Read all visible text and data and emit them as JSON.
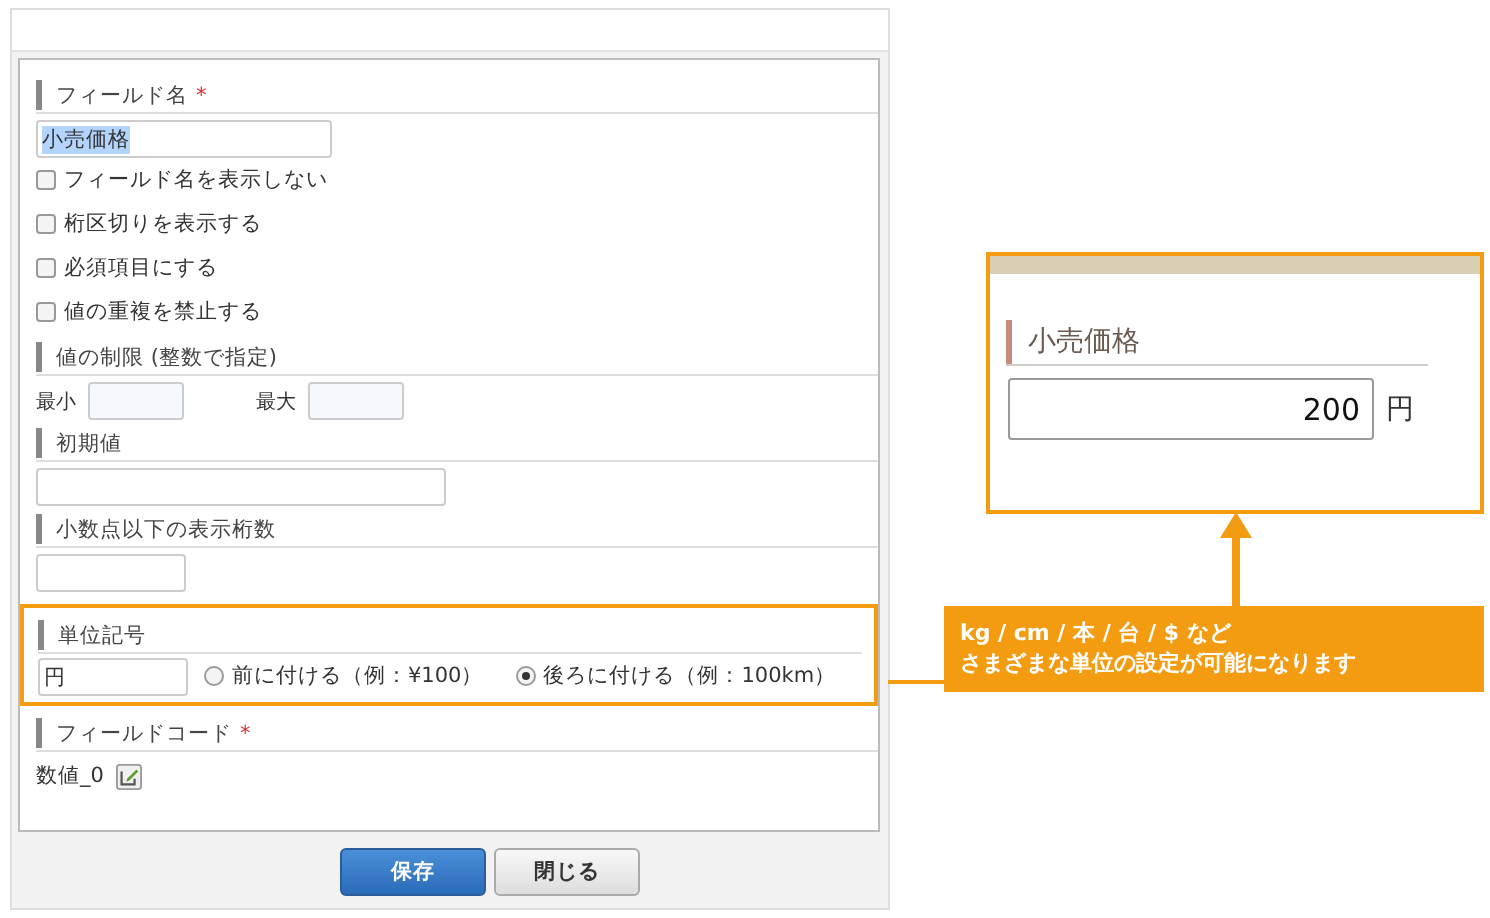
{
  "field_name": {
    "label": "フィールド名",
    "required_mark": "*",
    "value": "小売価格",
    "value_selected": true
  },
  "options": [
    {
      "label": "フィールド名を表示しない",
      "checked": false
    },
    {
      "label": "桁区切りを表示する",
      "checked": false
    },
    {
      "label": "必須項目にする",
      "checked": false
    },
    {
      "label": "値の重複を禁止する",
      "checked": false
    }
  ],
  "limit": {
    "label": "値の制限 (整数で指定)",
    "min_label": "最小",
    "max_label": "最大"
  },
  "default_value": {
    "label": "初期値"
  },
  "decimals": {
    "label": "小数点以下の表示桁数"
  },
  "unit": {
    "label": "単位記号",
    "value": "円",
    "highlighted": true,
    "positions": [
      {
        "label": "前に付ける（例：¥100）",
        "selected": false
      },
      {
        "label": "後ろに付ける（例：100km）",
        "selected": true
      }
    ]
  },
  "field_code": {
    "label": "フィールドコード",
    "required_mark": "*",
    "value": "数値_0"
  },
  "buttons": [
    {
      "label": "保存",
      "kind": "primary"
    },
    {
      "label": "閉じる",
      "kind": "secondary"
    }
  ],
  "preview": {
    "label": "小売価格",
    "value": "200",
    "unit": "円"
  },
  "callout": {
    "lines": [
      "kg / cm / 本 / 台 / $ など",
      "さまざまな単位の設定が可能になります"
    ]
  }
}
